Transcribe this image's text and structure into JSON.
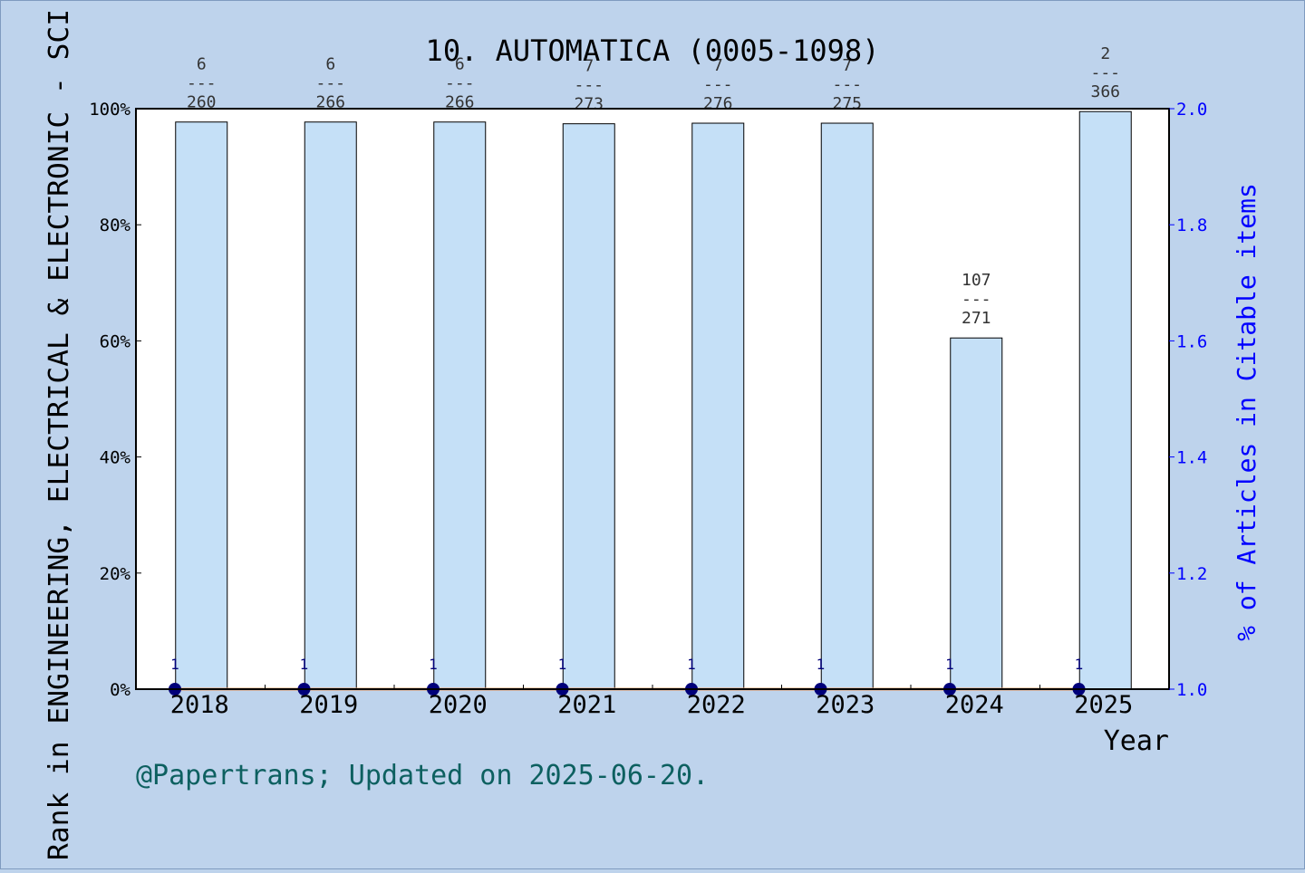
{
  "chart_data": {
    "type": "bar",
    "title": "10. AUTOMATICA (0005-1098)",
    "xlabel": "Year",
    "ylabel": "Rank in ENGINEERING, ELECTRICAL & ELECTRONIC - SCI",
    "y2label": "% of Articles in Citable items",
    "footer": "@Papertrans; Updated on 2025-06-20.",
    "categories": [
      "2018",
      "2019",
      "2020",
      "2021",
      "2022",
      "2023",
      "2024",
      "2025"
    ],
    "ylim": [
      0,
      100
    ],
    "y_ticks": [
      "0%",
      "20%",
      "40%",
      "60%",
      "80%",
      "100%"
    ],
    "y2lim": [
      1.0,
      2.0
    ],
    "y2_ticks": [
      "1.0",
      "1.2",
      "1.4",
      "1.6",
      "1.8",
      "2.0"
    ],
    "rank_percentile": [
      97.7,
      97.7,
      97.7,
      97.4,
      97.5,
      97.5,
      60.5,
      99.5
    ],
    "rank_labels": [
      {
        "rank": "6",
        "total": "260"
      },
      {
        "rank": "6",
        "total": "266"
      },
      {
        "rank": "6",
        "total": "266"
      },
      {
        "rank": "7",
        "total": "273"
      },
      {
        "rank": "7",
        "total": "276"
      },
      {
        "rank": "7",
        "total": "275"
      },
      {
        "rank": "107",
        "total": "271"
      },
      {
        "rank": "2",
        "total": "366"
      }
    ],
    "separator": "---",
    "article_pct": [
      1.0,
      1.0,
      1.0,
      1.0,
      1.0,
      1.0,
      1.0,
      1.0
    ],
    "point_labels": [
      "1",
      "1",
      "1",
      "1",
      "1",
      "1",
      "1",
      "1"
    ],
    "colors": {
      "background": "#bed3ec",
      "plot": "#ffffff",
      "bar": "#c5e0f7",
      "line": "#f4a06a",
      "marker": "#00007a",
      "right_axis": "#0000ff",
      "footer": "#0d6060"
    }
  }
}
